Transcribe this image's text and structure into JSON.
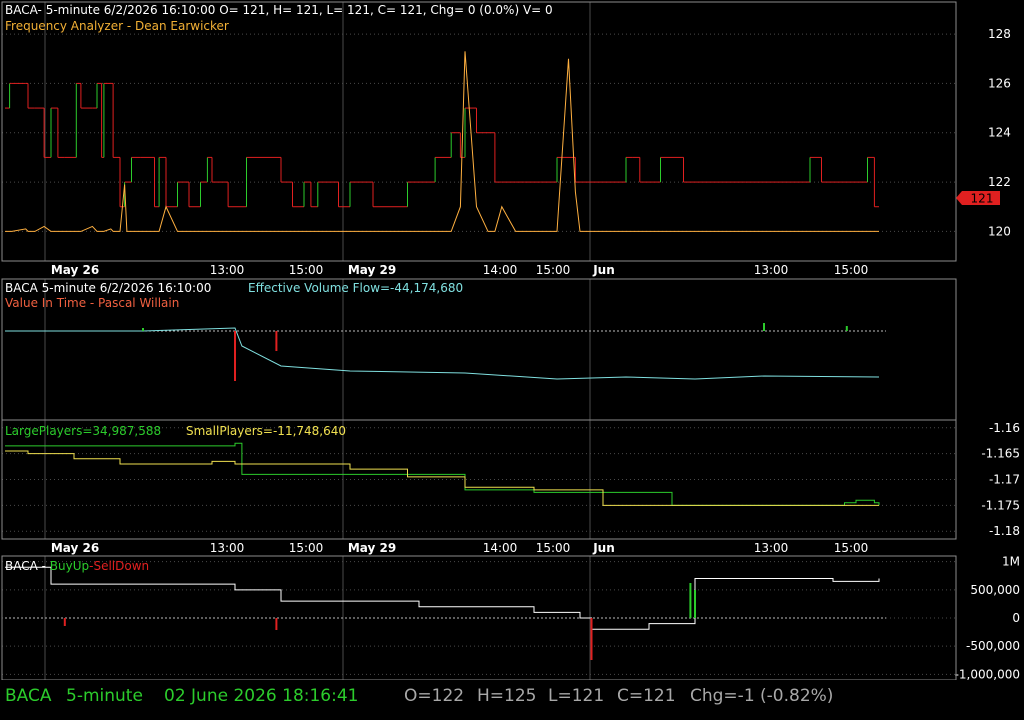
{
  "colors": {
    "background": "#000000",
    "border": "#8c8c8c",
    "grid": "#4a4a4a",
    "text": "#ffffff",
    "title": "#f2b035",
    "red": "#e02020",
    "green": "#2ccc2c",
    "yellow": "#f0e050",
    "orange": "#ffb040",
    "cyan": "#80e0e0",
    "light_green": "#80ff80",
    "status_green": "#2ccc2c",
    "status_gray": "#a8a8a8"
  },
  "panels": {
    "price": {
      "header": "BACA- 5-minute 6/2/2026 16:10:00 O= 121, H= 121, L= 121, C= 121, Chg= 0 (0.0%) V= 0",
      "indicator": "Frequency Analyzer - Dean Earwicker",
      "price_tag": "121"
    },
    "evf": {
      "header_left": "BACA 5-minute  6/2/2026 16:10:00",
      "header_right": "Effective Volume Flow=-44,174,680",
      "indicator": "Value In Time - Pascal Willain"
    },
    "players": {
      "large": "LargePlayers=34,987,588",
      "small": "SmallPlayers=-11,748,640"
    },
    "buyup": {
      "prefix": "BACA - ",
      "buy": "BuyUp",
      "dash": "-",
      "sell": "SellDown"
    }
  },
  "status": {
    "symbol": "BACA",
    "interval": "5-minute",
    "datetime": "02 June 2026 18:16:41",
    "open": "O=122",
    "high": "H=125",
    "low": "L=121",
    "close": "C=121",
    "change": "Chg=-1 (-0.82%)"
  },
  "chart_data": [
    {
      "type": "line",
      "panel": "price",
      "x_axis_labels": [
        "May 26",
        "13:00",
        "15:00",
        "May 29",
        "14:00",
        "15:00",
        "Jun",
        "13:00",
        "15:00"
      ],
      "y_ticks": [
        120,
        122,
        124,
        126,
        128
      ],
      "ylim": [
        118.8,
        129.3
      ],
      "last_value": 121,
      "series": [
        {
          "color": "red/green step",
          "x": [
            0,
            2,
            3,
            9,
            10,
            13,
            17,
            20,
            23,
            26,
            31,
            33,
            38,
            40,
            42,
            43,
            46,
            47,
            50,
            52,
            53,
            55,
            59,
            65,
            67,
            70,
            75,
            80,
            85,
            88,
            90,
            93,
            95,
            97,
            100,
            105,
            110,
            115,
            120,
            125,
            130,
            133,
            136,
            140,
            145,
            150,
            155,
            160,
            165,
            170,
            175,
            180,
            185,
            187,
            190,
            194,
            198,
            200,
            205,
            210,
            213,
            216,
            222,
            226,
            230,
            233,
            237,
            240,
            245,
            248,
            250,
            255,
            260,
            265,
            270,
            273,
            276,
            280,
            285,
            290,
            295,
            300,
            305,
            310,
            315,
            320,
            322,
            326,
            330,
            335,
            340,
            345,
            350,
            355,
            360,
            365,
            370,
            375,
            378,
            380
          ],
          "y": [
            125,
            126,
            126,
            126,
            125,
            125,
            123,
            125,
            123,
            123,
            126,
            125,
            125,
            126,
            123,
            126,
            126,
            123,
            121,
            122,
            122,
            123,
            123,
            121,
            123,
            121,
            122,
            121,
            122,
            123,
            122,
            122,
            122,
            121,
            121,
            123,
            123,
            123,
            122,
            121,
            122,
            121,
            122,
            122,
            121,
            122,
            122,
            121,
            121,
            121,
            122,
            122,
            122,
            123,
            123,
            124,
            123,
            125,
            124,
            124,
            122,
            122,
            122,
            122,
            122,
            122,
            122,
            123,
            123,
            122,
            122,
            122,
            122,
            122,
            123,
            123,
            122,
            122,
            123,
            123,
            122,
            122,
            122,
            122,
            122,
            122,
            122,
            122,
            122,
            122,
            122,
            122,
            123,
            122,
            122,
            122,
            122,
            123,
            121,
            121
          ]
        },
        {
          "color": "orange",
          "x": [
            0,
            2,
            3,
            9,
            10,
            13,
            17,
            20,
            23,
            26,
            31,
            33,
            38,
            40,
            42,
            43,
            46,
            47,
            50,
            52,
            53,
            55,
            59,
            65,
            67,
            70,
            75,
            80,
            85,
            88,
            90,
            93,
            95,
            97,
            100,
            105,
            110,
            115,
            120,
            125,
            130,
            133,
            136,
            140,
            145,
            150,
            155,
            160,
            165,
            170,
            175,
            180,
            185,
            187,
            190,
            194,
            198,
            200,
            205,
            210,
            213,
            216,
            222,
            226,
            230,
            233,
            237,
            240,
            245,
            248,
            250,
            255,
            260,
            265,
            270,
            273,
            276,
            280,
            285,
            290,
            295,
            300,
            305,
            310,
            315,
            320,
            322,
            326,
            330,
            335,
            340,
            345,
            350,
            355,
            360,
            365,
            370,
            375,
            378,
            380
          ],
          "y": [
            120,
            120,
            120,
            120.1,
            120,
            120,
            120.2,
            120,
            120,
            120,
            120,
            120,
            120.2,
            120,
            120,
            120,
            120.1,
            120,
            120,
            121.9,
            120,
            120,
            120,
            120,
            120,
            121,
            120,
            120,
            120,
            120,
            120,
            120,
            120,
            120,
            120,
            120,
            120,
            120,
            120,
            120,
            120,
            120,
            120,
            120,
            120,
            120,
            120,
            120,
            120,
            120,
            120,
            120,
            120,
            120,
            120,
            120,
            121,
            127.3,
            121,
            120,
            120,
            121,
            120,
            120,
            120,
            120,
            120,
            120,
            127,
            121.6,
            120,
            120,
            120,
            120,
            120,
            120,
            120,
            120,
            120,
            120,
            120,
            120,
            120,
            120,
            120,
            120,
            120,
            120,
            120,
            120,
            120,
            120,
            120,
            120,
            120,
            120,
            120,
            120,
            120,
            120
          ]
        }
      ]
    },
    {
      "type": "line",
      "panel": "effective-volume-flow",
      "series": [
        {
          "name": "Effective Volume Flow",
          "color": "cyan",
          "x": [
            0,
            30,
            60,
            100,
            103,
            120,
            150,
            200,
            240,
            270,
            300,
            330,
            380
          ],
          "y": [
            0,
            0,
            0,
            3,
            -15,
            -35,
            -40,
            -42,
            -48,
            -46,
            -48,
            -45,
            -46
          ]
        }
      ]
    },
    {
      "type": "line",
      "panel": "players",
      "y_ticks": [
        -1.16,
        -1.165,
        -1.17,
        -1.175,
        -1.18
      ],
      "ylim": [
        -1.1815,
        -1.1585
      ],
      "series": [
        {
          "name": "LargePlayers",
          "color": "green",
          "x": [
            0,
            10,
            30,
            50,
            60,
            90,
            100,
            103,
            120,
            150,
            175,
            200,
            230,
            260,
            270,
            290,
            340,
            360,
            365,
            370,
            378,
            380
          ],
          "y": [
            -1.1635,
            -1.1635,
            -1.1635,
            -1.1635,
            -1.1635,
            -1.1635,
            -1.163,
            -1.169,
            -1.169,
            -1.169,
            -1.169,
            -1.172,
            -1.1725,
            -1.1725,
            -1.1725,
            -1.175,
            -1.175,
            -1.175,
            -1.1745,
            -1.174,
            -1.1745,
            -1.175
          ]
        },
        {
          "name": "SmallPlayers",
          "color": "yellow",
          "x": [
            0,
            10,
            30,
            50,
            60,
            90,
            100,
            103,
            120,
            150,
            175,
            200,
            230,
            260,
            270,
            290,
            340,
            360,
            365,
            370,
            378,
            380
          ],
          "y": [
            -1.1645,
            -1.165,
            -1.166,
            -1.167,
            -1.167,
            -1.1665,
            -1.167,
            -1.167,
            -1.167,
            -1.168,
            -1.1695,
            -1.1715,
            -1.172,
            -1.175,
            -1.175,
            -1.175,
            -1.175,
            -1.175,
            -1.175,
            -1.175,
            -1.175,
            -1.175
          ]
        }
      ]
    },
    {
      "type": "line",
      "panel": "buyup-selldown",
      "x_axis_labels": [
        "May 26",
        "13:00",
        "15:00",
        "May 29",
        "14:00",
        "15:00",
        "Jun",
        "13:00",
        "15:00"
      ],
      "y_tick_labels": [
        "1M",
        "500,000",
        "0",
        "-500,000",
        "-1,000,000"
      ],
      "ylim": [
        -1100000,
        1100000
      ],
      "series": [
        {
          "color": "white",
          "x": [
            0,
            20,
            40,
            60,
            80,
            100,
            120,
            140,
            160,
            180,
            200,
            230,
            250,
            255,
            260,
            275,
            280,
            300,
            320,
            340,
            360,
            380
          ],
          "y": [
            900000,
            600000,
            600000,
            600000,
            600000,
            500000,
            300000,
            300000,
            300000,
            200000,
            200000,
            100000,
            0,
            -200000,
            -200000,
            -200000,
            -100000,
            700000,
            700000,
            700000,
            650000,
            700000
          ]
        }
      ]
    }
  ]
}
